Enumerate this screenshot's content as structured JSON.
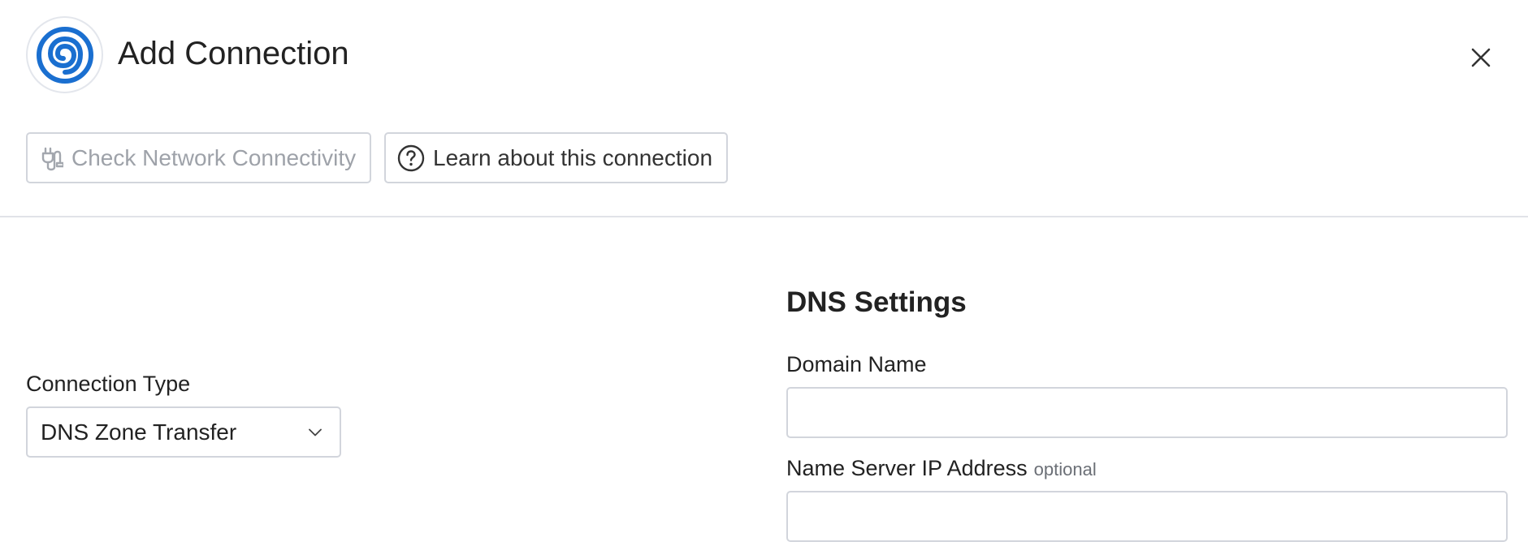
{
  "header": {
    "title": "Add Connection",
    "logo_icon": "spiral-logo-icon",
    "close_icon": "close-icon"
  },
  "toolbar": {
    "check_network_label": "Check Network Connectivity",
    "check_network_icon": "network-plug-icon",
    "check_network_disabled": true,
    "learn_label": "Learn about this connection",
    "learn_icon": "help-circle-icon"
  },
  "form": {
    "connection_type_label": "Connection Type",
    "connection_type_value": "DNS Zone Transfer",
    "dns_section_title": "DNS Settings",
    "domain_name_label": "Domain Name",
    "domain_name_value": "",
    "name_server_label": "Name Server IP Address",
    "name_server_optional": "optional",
    "name_server_value": ""
  },
  "colors": {
    "brand_blue": "#1a6fd0",
    "border": "#d2d5dc",
    "disabled_text": "#9ea2a9"
  }
}
